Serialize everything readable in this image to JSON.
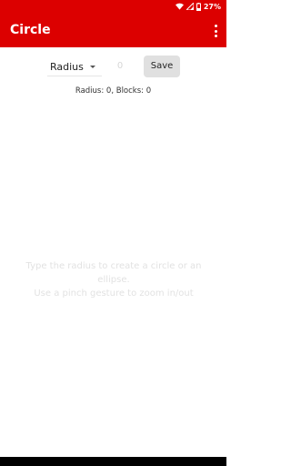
{
  "status": {
    "battery": "27%"
  },
  "appbar": {
    "title": "Circle"
  },
  "form": {
    "shape_select": "Radius",
    "radius_value": "0",
    "save_label": "Save"
  },
  "info_text": "Radius: 0, Blocks: 0",
  "hint": {
    "line1": "Type the radius to create a circle or an ellipse.",
    "line2": "Use a pinch gesture to zoom in/out"
  },
  "colors": {
    "appbar": "#dc0000",
    "button": "#e0e0e0"
  }
}
